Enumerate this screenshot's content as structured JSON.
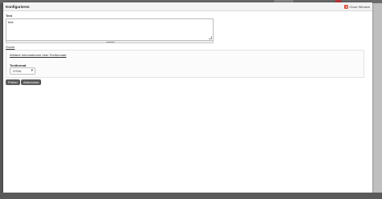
{
  "dialog": {
    "title": "Konfigurieren",
    "close_label": "Close Window"
  },
  "text_field": {
    "label": "Text",
    "value": "test"
  },
  "search_link": "Suche",
  "formats": {
    "more_info_link": "Weitere Informationen über Textformate",
    "label": "Textformat",
    "selected": "HTML"
  },
  "buttons": {
    "save": "Prüfen",
    "cancel": "Abbrechen"
  }
}
